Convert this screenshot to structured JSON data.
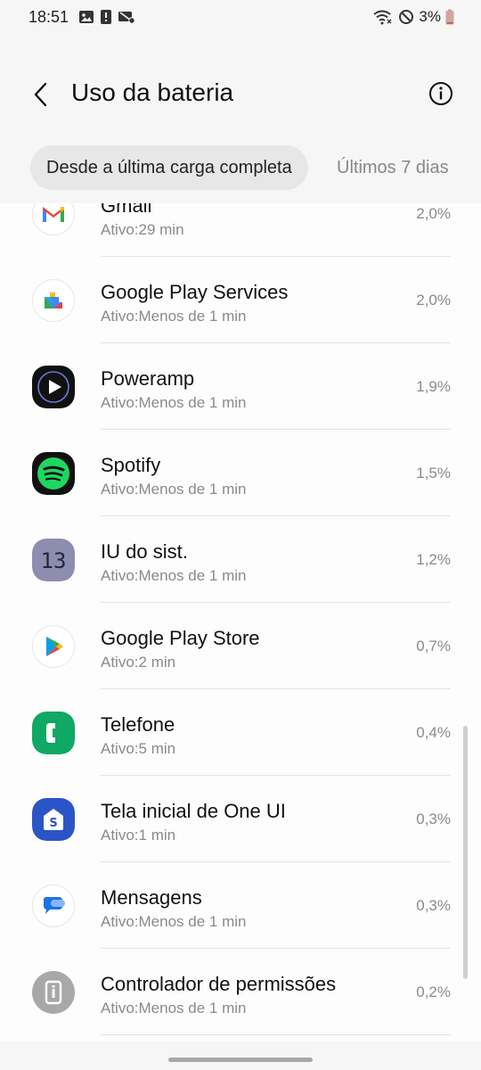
{
  "status_bar": {
    "time": "18:51",
    "battery_percent": "3%",
    "left_icons": [
      "gallery-icon",
      "alert-icon",
      "no-sync-icon"
    ],
    "right_icons": [
      "wifi-icon",
      "do-not-disturb-icon",
      "battery-icon"
    ]
  },
  "header": {
    "title": "Uso da bateria"
  },
  "tabs": [
    {
      "label": "Desde a última carga completa",
      "selected": true
    },
    {
      "label": "Últimos 7 dias",
      "selected": false
    }
  ],
  "apps": [
    {
      "name": "Gmail",
      "active": "Ativo:29 min",
      "percent": "2,0%",
      "icon": "gmail-icon"
    },
    {
      "name": "Google Play Services",
      "active": "Ativo:Menos de 1 min",
      "percent": "2,0%",
      "icon": "google-play-services-icon"
    },
    {
      "name": "Poweramp",
      "active": "Ativo:Menos de 1 min",
      "percent": "1,9%",
      "icon": "poweramp-icon"
    },
    {
      "name": "Spotify",
      "active": "Ativo:Menos de 1 min",
      "percent": "1,5%",
      "icon": "spotify-icon"
    },
    {
      "name": "IU do sist.",
      "active": "Ativo:Menos de 1 min",
      "percent": "1,2%",
      "icon": "system-ui-icon",
      "icon_text": "13"
    },
    {
      "name": "Google Play Store",
      "active": "Ativo:2 min",
      "percent": "0,7%",
      "icon": "play-store-icon"
    },
    {
      "name": "Telefone",
      "active": "Ativo:5 min",
      "percent": "0,4%",
      "icon": "phone-icon"
    },
    {
      "name": "Tela inicial de One UI",
      "active": "Ativo:1 min",
      "percent": "0,3%",
      "icon": "one-ui-home-icon"
    },
    {
      "name": "Mensagens",
      "active": "Ativo:Menos de 1 min",
      "percent": "0,3%",
      "icon": "messages-icon"
    },
    {
      "name": "Controlador de permissões",
      "active": "Ativo:Menos de 1 min",
      "percent": "0,2%",
      "icon": "permission-controller-icon"
    }
  ],
  "colors": {
    "background": "#f6f6f6",
    "card": "#fdfdfd",
    "tab_active_bg": "#e7e7e7",
    "secondary_text": "#8a8a8a"
  }
}
